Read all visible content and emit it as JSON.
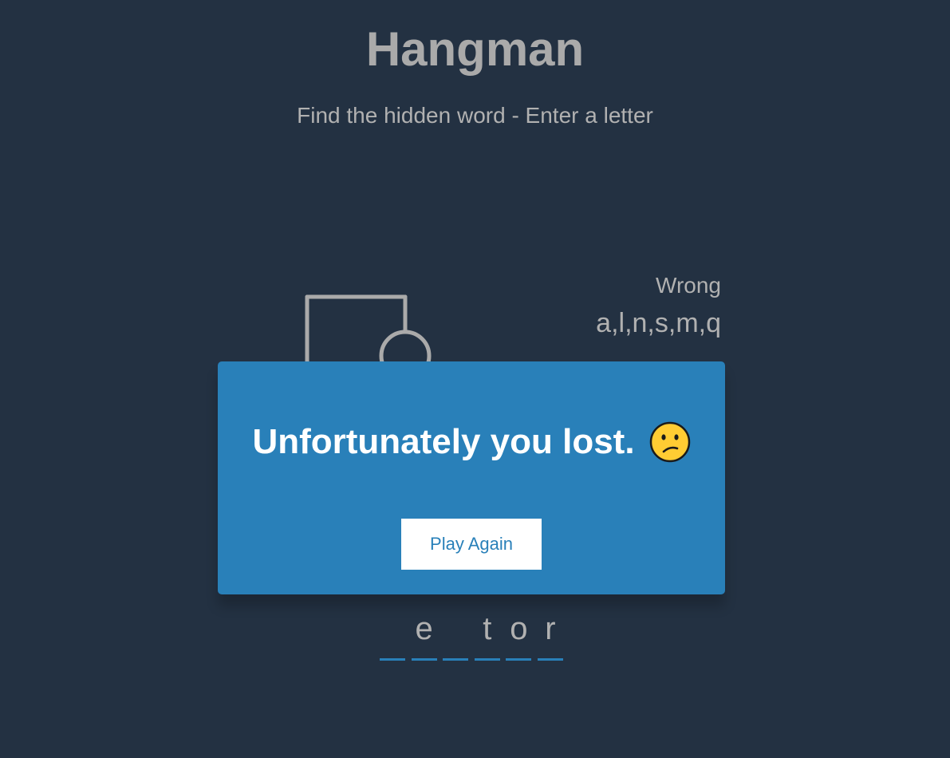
{
  "header": {
    "title": "Hangman",
    "subtitle": "Find the hidden word - Enter a letter"
  },
  "wrong": {
    "label": "Wrong",
    "letters": "a,l,n,s,m,q"
  },
  "word": {
    "slots": [
      "",
      "e",
      "",
      "t",
      "o",
      "r"
    ]
  },
  "popup": {
    "message": "Unfortunately you lost.",
    "emoji": "confused-face-icon",
    "button_label": "Play Again"
  },
  "colors": {
    "background": "#233142",
    "accent": "#2980b9",
    "text": "#b1b1b1",
    "figure": "#aaaaaa"
  }
}
